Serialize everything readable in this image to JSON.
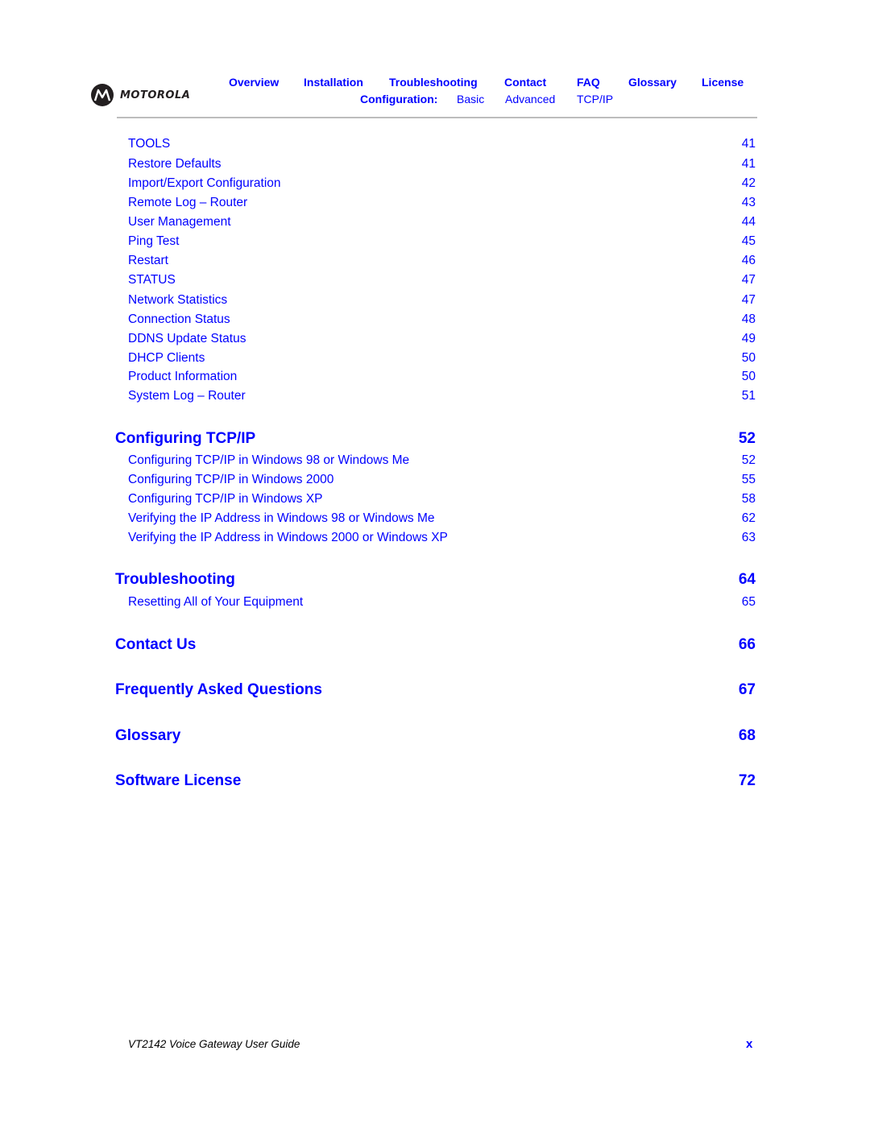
{
  "header": {
    "brand": "MOTOROLA",
    "nav": [
      {
        "label": "Overview"
      },
      {
        "label": "Installation"
      },
      {
        "label": "Troubleshooting"
      },
      {
        "label": "Contact"
      },
      {
        "label": "FAQ"
      },
      {
        "label": "Glossary"
      },
      {
        "label": "License"
      }
    ],
    "subnav": {
      "label": "Configuration:",
      "links": [
        {
          "label": "Basic"
        },
        {
          "label": "Advanced"
        },
        {
          "label": "TCP/IP"
        }
      ]
    }
  },
  "toc": {
    "sub_entries_top": [
      {
        "title": "TOOLS",
        "page": "41"
      },
      {
        "title": "Restore Defaults",
        "page": "41"
      },
      {
        "title": "Import/Export Configuration",
        "page": "42"
      },
      {
        "title": "Remote Log – Router",
        "page": "43"
      },
      {
        "title": "User Management",
        "page": "44"
      },
      {
        "title": "Ping Test",
        "page": "45"
      },
      {
        "title": "Restart",
        "page": "46"
      },
      {
        "title": "STATUS",
        "page": "47"
      },
      {
        "title": "Network Statistics",
        "page": "47"
      },
      {
        "title": "Connection Status",
        "page": "48"
      },
      {
        "title": "DDNS Update Status",
        "page": "49"
      },
      {
        "title": "DHCP Clients",
        "page": "50"
      },
      {
        "title": "Product Information",
        "page": "50"
      },
      {
        "title": "System Log – Router",
        "page": "51"
      }
    ],
    "chapters": [
      {
        "title": "Configuring TCP/IP",
        "page": "52",
        "entries": [
          {
            "title": "Configuring TCP/IP in Windows 98 or Windows Me",
            "page": "52"
          },
          {
            "title": "Configuring TCP/IP in Windows 2000",
            "page": "55"
          },
          {
            "title": "Configuring TCP/IP in Windows XP",
            "page": "58"
          },
          {
            "title": "Verifying the IP Address in Windows 98 or Windows Me",
            "page": "62"
          },
          {
            "title": "Verifying the IP Address in Windows 2000 or Windows XP",
            "page": "63"
          }
        ]
      },
      {
        "title": "Troubleshooting",
        "page": "64",
        "entries": [
          {
            "title": "Resetting All of Your Equipment",
            "page": "65"
          }
        ]
      },
      {
        "title": "Contact Us",
        "page": "66",
        "entries": []
      },
      {
        "title": "Frequently Asked Questions",
        "page": "67",
        "entries": []
      },
      {
        "title": "Glossary",
        "page": "68",
        "entries": []
      },
      {
        "title": "Software License",
        "page": "72",
        "entries": []
      }
    ]
  },
  "footer": {
    "document_title": "VT2142 Voice Gateway User Guide",
    "page_number": "x"
  }
}
